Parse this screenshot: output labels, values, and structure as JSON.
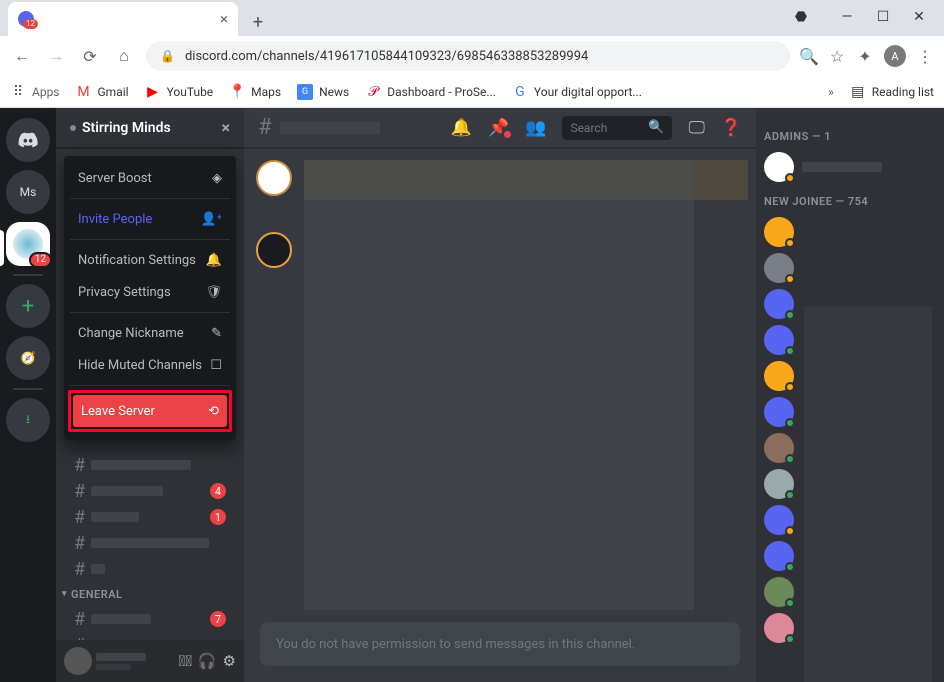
{
  "browser": {
    "tab_badge": "12",
    "url": "discord.com/channels/419617105844109323/698546338853289994",
    "avatar_letter": "A",
    "bookmarks": {
      "apps": "Apps",
      "gmail": "Gmail",
      "youtube": "YouTube",
      "maps": "Maps",
      "news": "News",
      "dashboard": "Dashboard - ProSe...",
      "opport": "Your digital opport...",
      "more": "»",
      "reading": "Reading list"
    }
  },
  "server_rail": {
    "ms_label": "Ms",
    "active_badge": "12"
  },
  "server": {
    "name": "Stirring Minds"
  },
  "context_menu": {
    "boost": "Server Boost",
    "invite": "Invite People",
    "notif": "Notification Settings",
    "privacy": "Privacy Settings",
    "nickname": "Change Nickname",
    "hide_muted": "Hide Muted Channels",
    "leave": "Leave Server"
  },
  "channels": {
    "general_category": "GENERAL",
    "badges": {
      "a": "4",
      "b": "1",
      "c": "7"
    }
  },
  "header": {
    "search_placeholder": "Search"
  },
  "input": {
    "placeholder": "You do not have permission to send messages in this channel."
  },
  "members": {
    "admins_header": "ADMINS — 1",
    "joinee_header": "NEW JOINEE — 754"
  }
}
